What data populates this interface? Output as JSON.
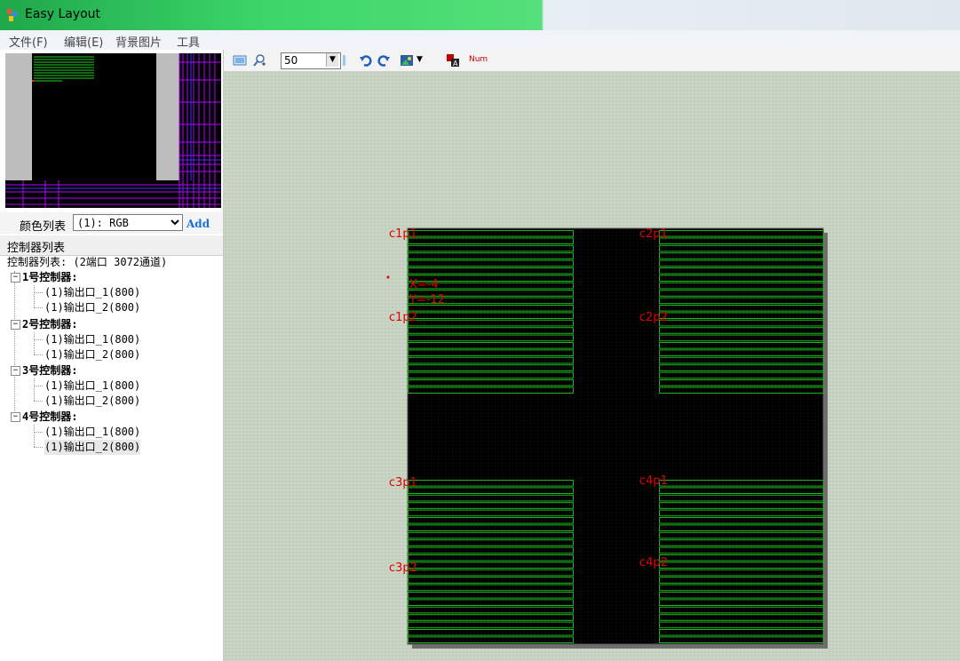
{
  "window": {
    "title": "Easy Layout"
  },
  "menu": [
    "文件(F)",
    "编辑(E)",
    "背景图片",
    "工具"
  ],
  "toolbar": {
    "zoom": "50",
    "num_label": "Num"
  },
  "color_list": {
    "label": "颜色列表",
    "selected": "(1): RGB",
    "add_label": "Add"
  },
  "controllers_panel": {
    "header": "控制器列表",
    "summary": "控制器列表: (2端口 3072通道)",
    "controllers": [
      {
        "name": "1号控制器:",
        "outputs": [
          "(1)输出口_1(800)",
          "(1)输出口_2(800)"
        ]
      },
      {
        "name": "2号控制器:",
        "outputs": [
          "(1)输出口_1(800)",
          "(1)输出口_2(800)"
        ]
      },
      {
        "name": "3号控制器:",
        "outputs": [
          "(1)输出口_1(800)",
          "(1)输出口_2(800)"
        ]
      },
      {
        "name": "4号控制器:",
        "outputs": [
          "(1)输出口_1(800)",
          "(1)输出口_2(800)"
        ]
      }
    ],
    "selected_output": "4号控制器 / (1)输出口_2(800)"
  },
  "layout": {
    "port_labels": [
      "c1p1",
      "c1p2",
      "c2p1",
      "c2p2",
      "c3p1",
      "c3p2",
      "c4p1",
      "c4p2"
    ],
    "coord_x": "X=-4",
    "coord_y": "Y=-12",
    "colors": {
      "background": "#000000",
      "strips": "#1db41d",
      "labels": "#e00000",
      "canvas": "#c9d4c4"
    }
  }
}
